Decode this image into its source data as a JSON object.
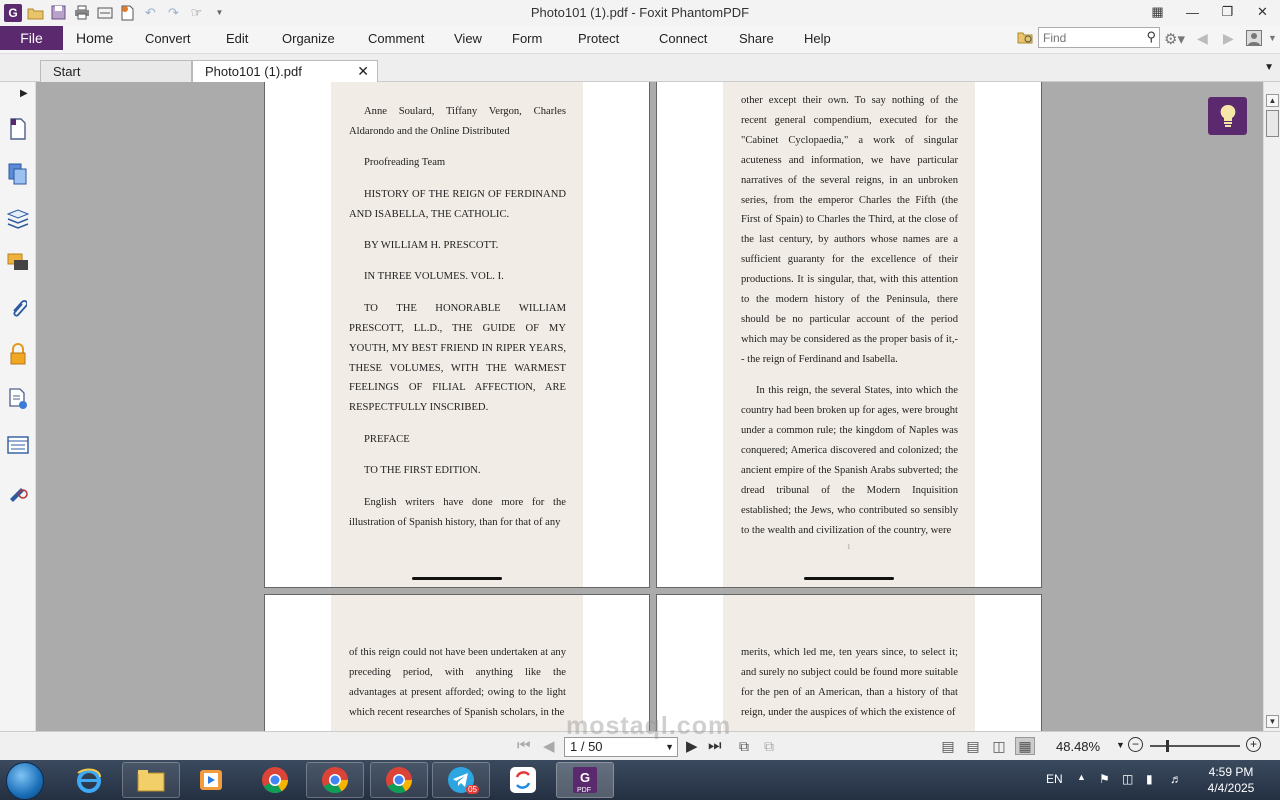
{
  "window": {
    "title": "Photo101 (1).pdf - Foxit PhantomPDF",
    "app_logo": "G",
    "controls": [
      "restore-grid-icon",
      "minimize-icon",
      "maximize-icon",
      "close-icon"
    ]
  },
  "colors": {
    "brand": "#5b2a6e",
    "workspace": "#ababab",
    "paper": "#f1ece5"
  },
  "menu": {
    "file": "File",
    "items": [
      "Home",
      "Convert",
      "Edit",
      "Organize",
      "Comment",
      "View",
      "Form",
      "Protect",
      "Connect",
      "Share",
      "Help"
    ]
  },
  "search": {
    "placeholder": "Find"
  },
  "tabs": [
    {
      "label": "Start"
    },
    {
      "label": "Photo101 (1).pdf",
      "active": true
    }
  ],
  "sidebar": {
    "icons": [
      "pages-icon",
      "copy-pages-icon",
      "layers-icon",
      "comments-icon",
      "attachment-icon",
      "security-lock-icon",
      "document-properties-icon",
      "content-panel-icon",
      "signature-icon"
    ]
  },
  "document": {
    "pages": [
      {
        "paragraphs": [
          "Anne Soulard, Tiffany Vergon, Charles Aldarondo and the Online Distributed",
          "Proofreading Team",
          "HISTORY OF THE REIGN OF FERDINAND AND ISABELLA, THE CATHOLIC.",
          "BY WILLIAM H. PRESCOTT.",
          "IN THREE VOLUMES. VOL. I.",
          "TO THE HONORABLE WILLIAM PRESCOTT, LL.D., THE GUIDE OF MY YOUTH, MY BEST FRIEND IN RIPER YEARS, THESE VOLUMES, WITH THE WARMEST FEELINGS OF FILIAL AFFECTION, ARE RESPECTFULLY INSCRIBED.",
          "PREFACE",
          "TO THE FIRST EDITION.",
          "English writers have done more for the illustration of Spanish history, than for that of any"
        ]
      },
      {
        "paragraphs": [
          "other except their own. To say nothing of the recent general compendium, executed for the \"Cabinet Cyclopaedia,\" a work of singular acuteness and information, we have particular narratives of the several reigns, in an unbroken series, from the emperor Charles the Fifth (the First of Spain) to Charles the Third, at the close of the last century, by authors whose names are a sufficient guaranty for the excellence of their productions. It is singular, that, with this attention to the modern history of the Peninsula, there should be no particular account of the period which may be considered as the proper basis of it,-- the reign of Ferdinand and Isabella.",
          "In this reign, the several States, into which the country had been broken up for ages, were brought under a common rule; the kingdom of Naples was conquered; America discovered and colonized; the ancient empire of the Spanish Arabs subverted; the dread tribunal of the Modern Inquisition established; the Jews, who contributed so sensibly to the wealth and civilization of the country, were"
        ],
        "footer_number": "1"
      },
      {
        "paragraphs": [
          "of this reign could not have been undertaken at any preceding period, with anything like the advantages at present afforded; owing to the light which recent researches of Spanish scholars, in the"
        ]
      },
      {
        "paragraphs": [
          "merits, which led me, ten years since, to select it; and surely no subject could be found more suitable for the pen of an American, than a history of that reign, under the auspices of which the existence of"
        ]
      }
    ]
  },
  "status": {
    "page_indicator": "1 / 50",
    "zoom": "48.48%"
  },
  "taskbar": {
    "apps": [
      "internet-explorer-icon",
      "file-explorer-icon",
      "media-player-icon",
      "chrome-icon",
      "chrome-icon",
      "chrome-icon",
      "telegram-icon",
      "sync-app-icon",
      "foxit-pdf-icon"
    ],
    "telegram_badge": "05",
    "pdf_label": "PDF",
    "language": "EN",
    "time": "4:59 PM",
    "date": "4/4/2025"
  },
  "watermark": "mostaql.com"
}
